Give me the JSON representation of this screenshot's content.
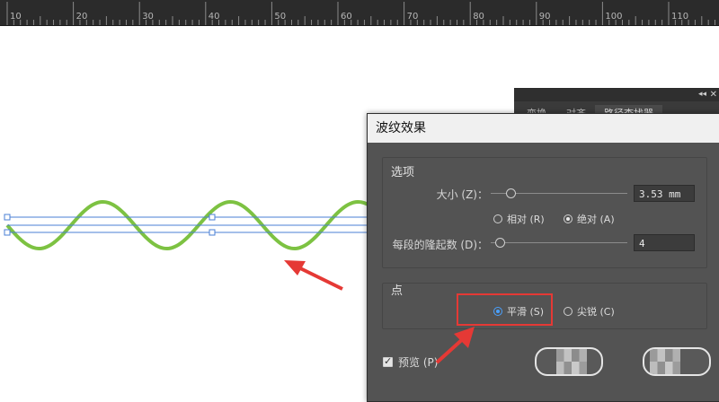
{
  "ruler": {
    "labels": [
      "10",
      "20",
      "30",
      "40",
      "50",
      "60",
      "70",
      "80",
      "90",
      "100",
      "110"
    ]
  },
  "back_panel": {
    "collapse_glyph": "◂◂",
    "close_glyph": "✕",
    "tabs": [
      "变换",
      "对齐",
      "路径查找器"
    ]
  },
  "dialog": {
    "title": "波纹效果",
    "options_group": {
      "title": "选项",
      "size_label": "大小 (Z)：",
      "size_value": "3.53 mm",
      "size_position": 0.0,
      "relative_label": "相对 (R)",
      "absolute_label": "绝对 (A)",
      "absolute_selected": true,
      "ridges_label": "每段的隆起数 (D)：",
      "ridges_value": "4",
      "ridges_position": 0.0
    },
    "points_group": {
      "title": "点",
      "smooth_label": "平滑 (S)",
      "corner_label": "尖锐 (C)",
      "smooth_selected": true
    },
    "preview_label": "预览 (P)",
    "preview_checked": true
  },
  "colors": {
    "wave": "#7dc242",
    "selection": "#4a7fd6",
    "annotation": "#e53935",
    "dialog_bg": "#535353",
    "radio_active": "#4aa1ff"
  }
}
